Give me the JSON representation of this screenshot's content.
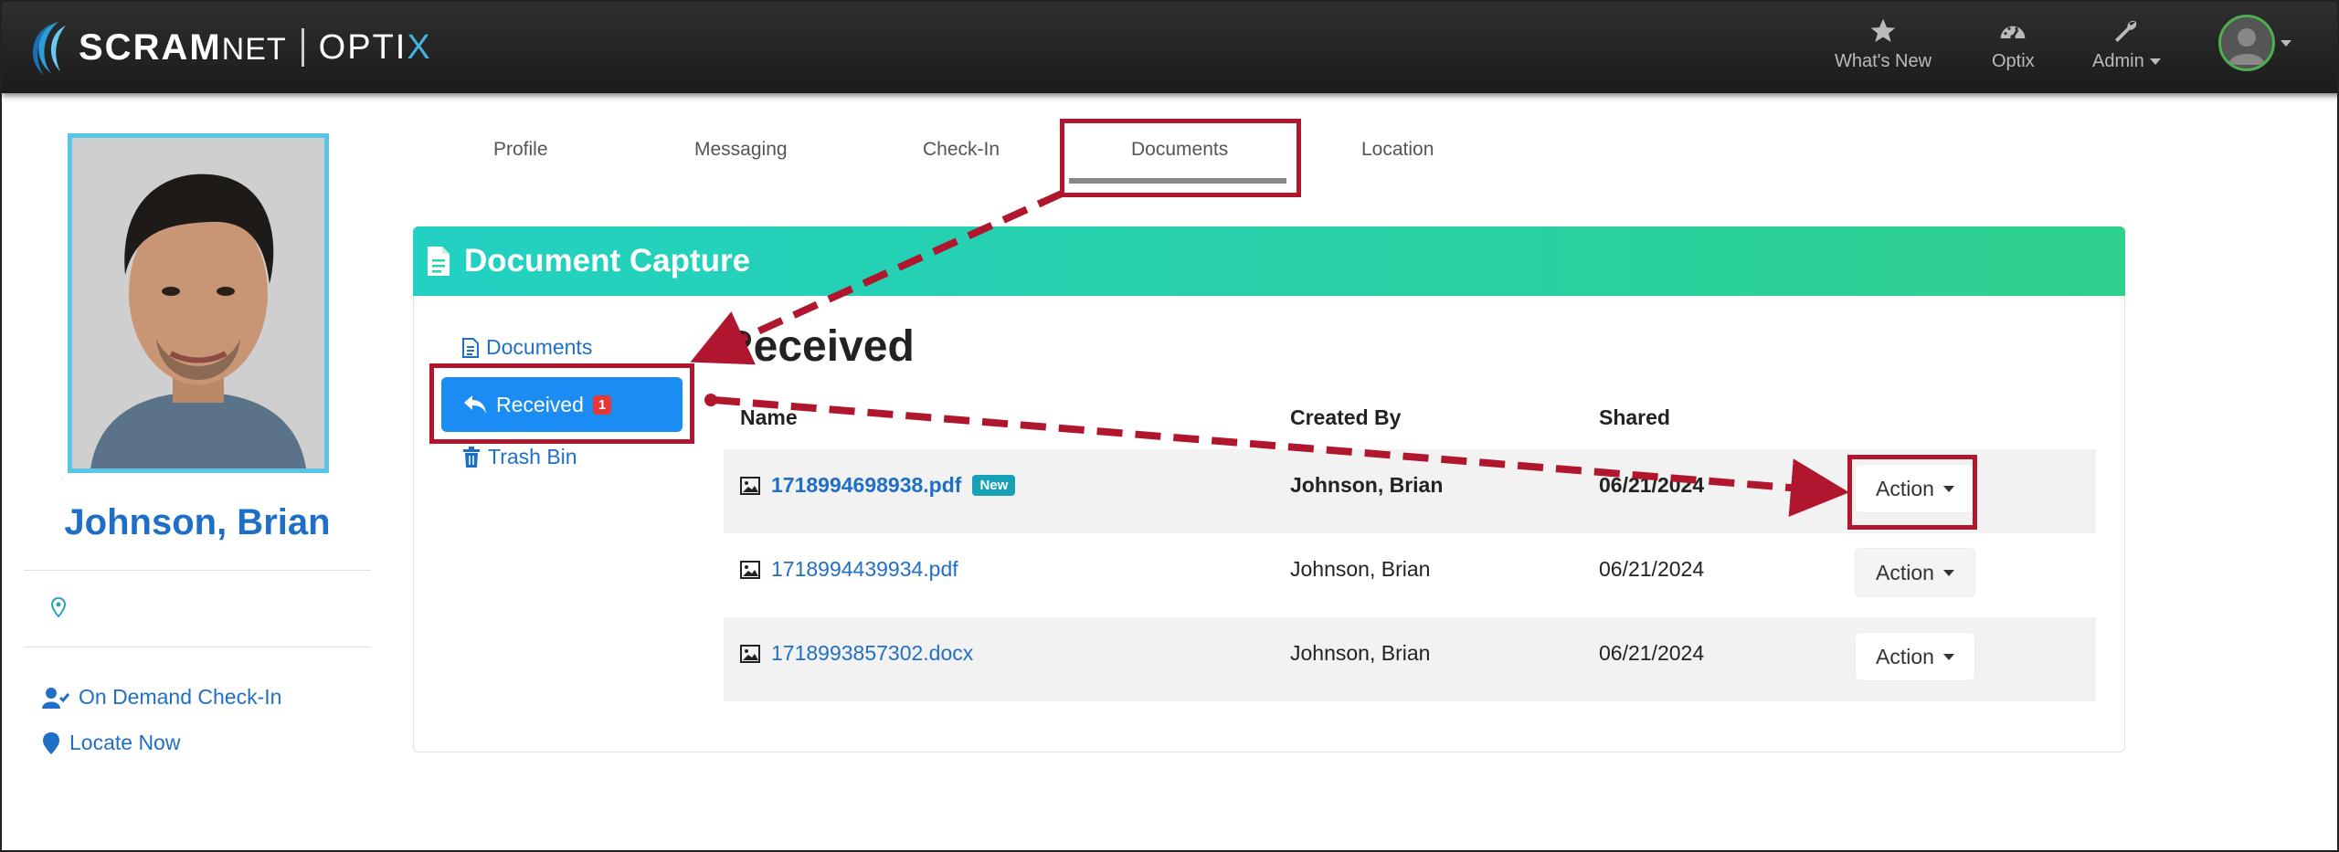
{
  "nav": {
    "brand_main": "SCRAM",
    "brand_net": "NET",
    "brand_product": "OPTI",
    "brand_product_x": "X",
    "items": [
      {
        "label": "What's New",
        "icon": "star-icon"
      },
      {
        "label": "Optix",
        "icon": "gauge-icon"
      },
      {
        "label": "Admin",
        "icon": "wrench-icon"
      }
    ],
    "user_icon": "user-avatar-icon"
  },
  "profile": {
    "name": "Johnson, Brian",
    "links": [
      {
        "label": "On Demand Check-In",
        "icon": "user-check-icon"
      },
      {
        "label": "Locate Now",
        "icon": "map-pin-icon"
      }
    ]
  },
  "tabs": [
    "Profile",
    "Messaging",
    "Check-In",
    "Documents",
    "Location"
  ],
  "active_tab": "Documents",
  "card": {
    "title": "Document Capture",
    "menu": {
      "documents": "Documents",
      "received": "Received",
      "received_count": "1",
      "trash": "Trash Bin"
    },
    "heading": "Received",
    "columns": [
      "Name",
      "Created By",
      "Shared"
    ],
    "rows": [
      {
        "file": "1718994698938.pdf",
        "badge": "New",
        "created_by": "Johnson, Brian",
        "shared": "06/21/2024",
        "action": "Action"
      },
      {
        "file": "1718994439934.pdf",
        "badge": "",
        "created_by": "Johnson, Brian",
        "shared": "06/21/2024",
        "action": "Action"
      },
      {
        "file": "1718993857302.docx",
        "badge": "",
        "created_by": "Johnson, Brian",
        "shared": "06/21/2024",
        "action": "Action"
      }
    ]
  },
  "colors": {
    "accent_blue": "#1a8cf4",
    "link_blue": "#1f6fc7",
    "header_gradient_start": "#22d1c3",
    "header_gradient_end": "#2dd08d",
    "annotation_red": "#b0172f"
  }
}
